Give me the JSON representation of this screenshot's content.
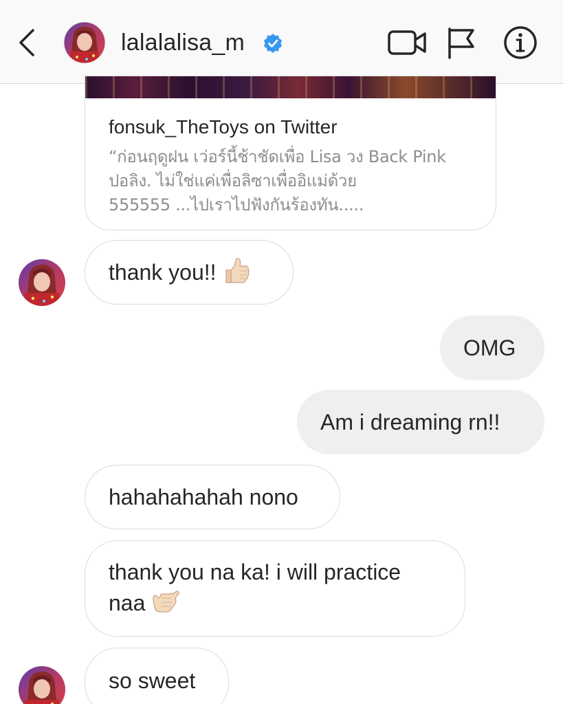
{
  "header": {
    "username": "lalalalisa_m",
    "verified": true,
    "icons": [
      "back-chevron-icon",
      "video-call-icon",
      "flag-icon",
      "info-icon"
    ]
  },
  "link_card": {
    "title": "fonsuk_TheToys on Twitter",
    "description_lines": [
      "“ก่อนฤดูฝน เว่อร์นี้ช้าชัดเพื่อ Lisa วง Back Pink",
      "ปอลิง. ไม่ใช่แค่เพื่อลิซาเพื่ออิแม่ด้วย",
      "555555 ...ไปเราไปฟังกันร้องทัน....."
    ]
  },
  "messages": [
    {
      "from": "them",
      "text": "thank you!!",
      "emoji": "thumbs-up"
    },
    {
      "from": "me",
      "text": "OMG"
    },
    {
      "from": "me",
      "text": "Am i dreaming rn!!"
    },
    {
      "from": "them",
      "text": "hahahahahah nono"
    },
    {
      "from": "them",
      "lines": [
        "thank you na ka! i will practice",
        "naa"
      ],
      "emoji": "call-me-hand"
    },
    {
      "from": "them",
      "text": "so sweet"
    }
  ],
  "colors": {
    "header_bg": "#f9f9f9",
    "verified_blue": "#3897f0",
    "bubble_border": "#dbdbdb",
    "outgoing_bubble": "#efefef",
    "muted_text": "#8e8e8e"
  }
}
